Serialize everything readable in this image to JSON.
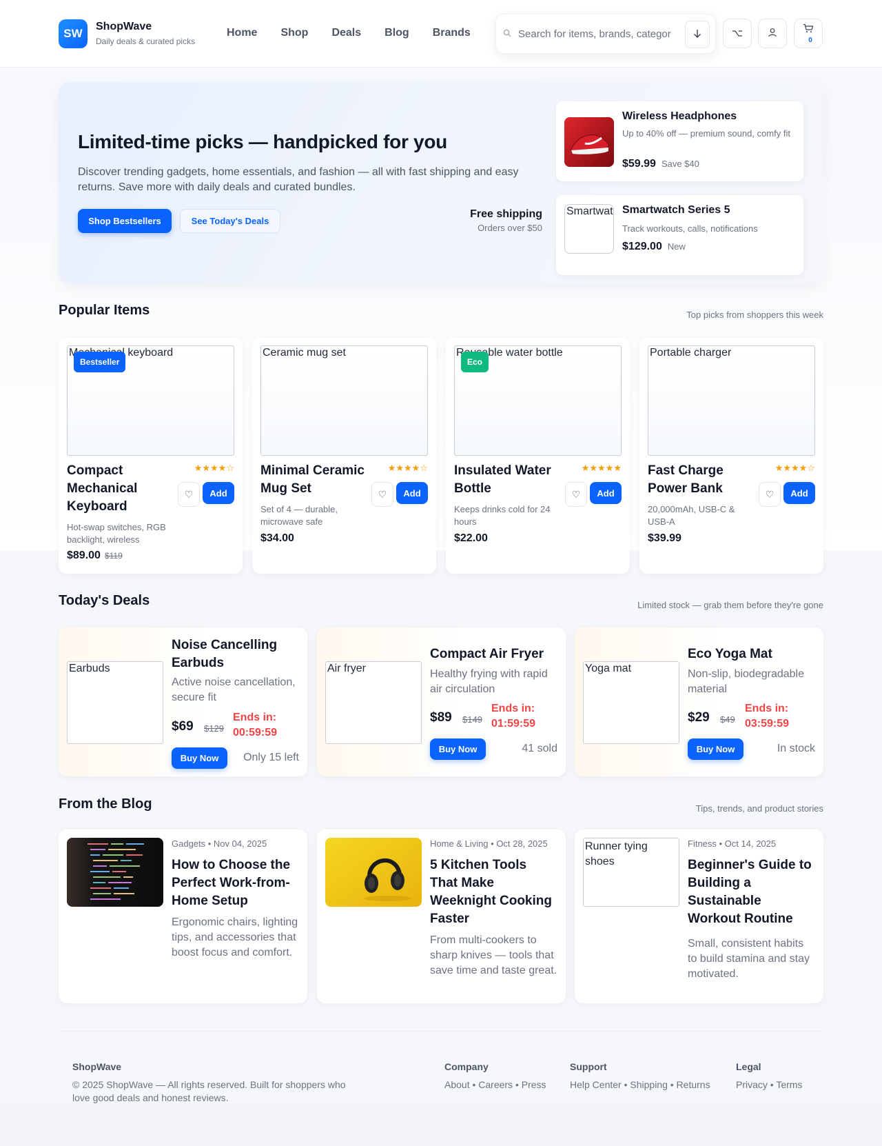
{
  "header": {
    "logo_text": "SW",
    "brand": "ShopWave",
    "tagline": "Daily deals & curated picks",
    "nav": [
      "Home",
      "Shop",
      "Deals",
      "Blog",
      "Brands"
    ],
    "search_placeholder": "Search for items, brands, categor",
    "cart_count": "0"
  },
  "hero": {
    "title": "Limited-time picks — handpicked for you",
    "subtitle": "Discover trending gadgets, home essentials, and fashion — all with fast shipping and easy returns. Save more with daily deals and curated bundles.",
    "primary_btn": "Shop Bestsellers",
    "secondary_btn": "See Today's Deals",
    "shipping_title": "Free shipping",
    "shipping_sub": "Orders over $50",
    "promos": [
      {
        "title": "Wireless Headphones",
        "desc": "Up to 40% off — premium sound, comfy fit",
        "price": "$59.99",
        "note": "Save $40",
        "img_alt": ""
      },
      {
        "title": "Smartwatch Series 5",
        "desc": "Track workouts, calls, notifications",
        "price": "$129.00",
        "note": "New",
        "img_alt": "Smartwatch"
      }
    ]
  },
  "popular": {
    "title": "Popular Items",
    "subtitle": "Top picks from shoppers this week",
    "items": [
      {
        "img_alt": "Mechanical keyboard",
        "badge": "Bestseller",
        "name": "Compact Mechanical Keyboard",
        "stars": "★★★★☆",
        "rating": 4,
        "desc": "Hot-swap switches, RGB backlight, wireless",
        "price": "$89.00",
        "old": "$119",
        "add": "Add"
      },
      {
        "img_alt": "Ceramic mug set",
        "badge": "",
        "name": "Minimal Ceramic Mug Set",
        "stars": "★★★★☆",
        "rating": 4,
        "desc": "Set of 4 — durable, microwave safe",
        "price": "$34.00",
        "old": "",
        "add": "Add"
      },
      {
        "img_alt": "Reusable water bottle",
        "badge": "Eco",
        "name": "Insulated Water Bottle",
        "stars": "★★★★★",
        "rating": 5,
        "desc": "Keeps drinks cold for 24 hours",
        "price": "$22.00",
        "old": "",
        "add": "Add"
      },
      {
        "img_alt": "Portable charger",
        "badge": "",
        "name": "Fast Charge Power Bank",
        "stars": "★★★★☆",
        "rating": 4,
        "desc": "20,000mAh, USB-C & USB-A",
        "price": "$39.99",
        "old": "",
        "add": "Add"
      }
    ]
  },
  "deals": {
    "title": "Today's Deals",
    "subtitle": "Limited stock — grab them before they're gone",
    "items": [
      {
        "img_alt": "Earbuds",
        "title": "Noise Cancelling Earbuds",
        "desc": "Active noise cancellation, secure fit",
        "price": "$69",
        "old": "$129",
        "ends_label": "Ends in:",
        "ends_time": "00:59:59",
        "buy": "Buy Now",
        "stock": "Only 15 left"
      },
      {
        "img_alt": "Air fryer",
        "title": "Compact Air Fryer",
        "desc": "Healthy frying with rapid air circulation",
        "price": "$89",
        "old": "$149",
        "ends_label": "Ends in:",
        "ends_time": "01:59:59",
        "buy": "Buy Now",
        "stock": "41 sold"
      },
      {
        "img_alt": "Yoga mat",
        "title": "Eco Yoga Mat",
        "desc": "Non-slip, biodegradable material",
        "price": "$29",
        "old": "$49",
        "ends_label": "Ends in:",
        "ends_time": "03:59:59",
        "buy": "Buy Now",
        "stock": "In stock"
      }
    ]
  },
  "blog": {
    "title": "From the Blog",
    "subtitle": "Tips, trends, and product stories",
    "posts": [
      {
        "meta": "Gadgets • Nov 04, 2025",
        "title": "How to Choose the Perfect Work-from-Home Setup",
        "desc": "Ergonomic chairs, lighting tips, and accessories that boost focus and comfort.",
        "img_alt": ""
      },
      {
        "meta": "Home & Living • Oct 28, 2025",
        "title": "5 Kitchen Tools That Make Weeknight Cooking Faster",
        "desc": "From multi-cookers to sharp knives — tools that save time and taste great.",
        "img_alt": ""
      },
      {
        "meta": "Fitness • Oct 14, 2025",
        "title": "Beginner's Guide to Building a Sustainable Workout Routine",
        "desc": "Small, consistent habits to build stamina and stay motivated.",
        "img_alt": "Runner tying shoes"
      }
    ]
  },
  "footer": {
    "brand": "ShopWave",
    "copyright": "© 2025 ShopWave — All rights reserved. Built for shoppers who love good deals and honest reviews.",
    "columns": [
      {
        "heading": "Company",
        "links": "About • Careers • Press"
      },
      {
        "heading": "Support",
        "links": "Help Center • Shipping • Returns"
      },
      {
        "heading": "Legal",
        "links": "Privacy • Terms"
      }
    ]
  },
  "colors": {
    "accent": "#0a63ff",
    "danger": "#ef4444",
    "star": "#f59e0b",
    "eco": "#10b981"
  }
}
